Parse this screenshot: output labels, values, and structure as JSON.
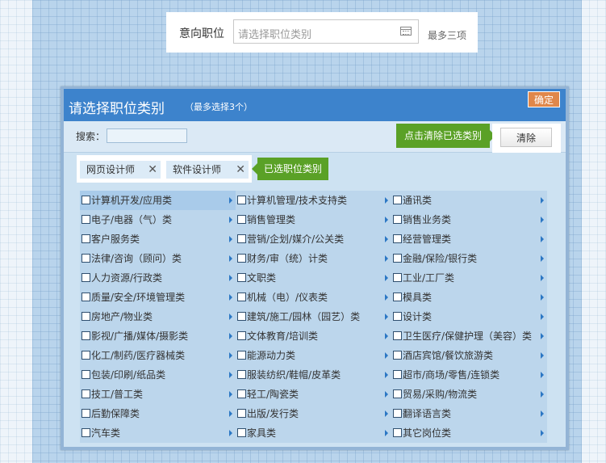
{
  "intent": {
    "label": "意向职位",
    "placeholder": "请选择职位类别",
    "hint": "最多三项"
  },
  "dialog": {
    "title": "请选择职位类别",
    "subtitle": "（最多选择3个）",
    "ok_label": "确定",
    "search_label": "搜索：",
    "clear_tip": "点击清除已选类别",
    "clear_label": "清除",
    "selected_tip": "已选职位类别",
    "selected": [
      {
        "label": "网页设计师",
        "remove": "✕"
      },
      {
        "label": "软件设计师",
        "remove": "✕"
      }
    ]
  },
  "categories": [
    [
      "计算机开发/应用类",
      "电子/电器（气）类",
      "客户服务类",
      "法律/咨询（顾问）类",
      "人力资源/行政类",
      "质量/安全/环境管理类",
      "房地产/物业类",
      "影视/广播/媒体/摄影类",
      "化工/制药/医疗器械类",
      "包装/印刷/纸品类",
      "技工/普工类",
      "后勤保障类",
      "汽车类"
    ],
    [
      "计算机管理/技术支持类",
      "销售管理类",
      "营销/企划/媒介/公关类",
      "财务/审（统）计类",
      "文职类",
      "机械（电）/仪表类",
      "建筑/施工/园林（园艺）类",
      "文体教育/培训类",
      "能源动力类",
      "服装纺织/鞋帽/皮革类",
      "轻工/陶瓷类",
      "出版/发行类",
      "家具类"
    ],
    [
      "通讯类",
      "销售业务类",
      "经营管理类",
      "金融/保险/银行类",
      "工业/工厂类",
      "模具类",
      "设计类",
      "卫生医疗/保健护理（美容）类",
      "酒店宾馆/餐饮旅游类",
      "超市/商场/零售/连锁类",
      "贸易/采购/物流类",
      "翻译语言类",
      "其它岗位类"
    ]
  ],
  "highlighted": "计算机开发/应用类"
}
